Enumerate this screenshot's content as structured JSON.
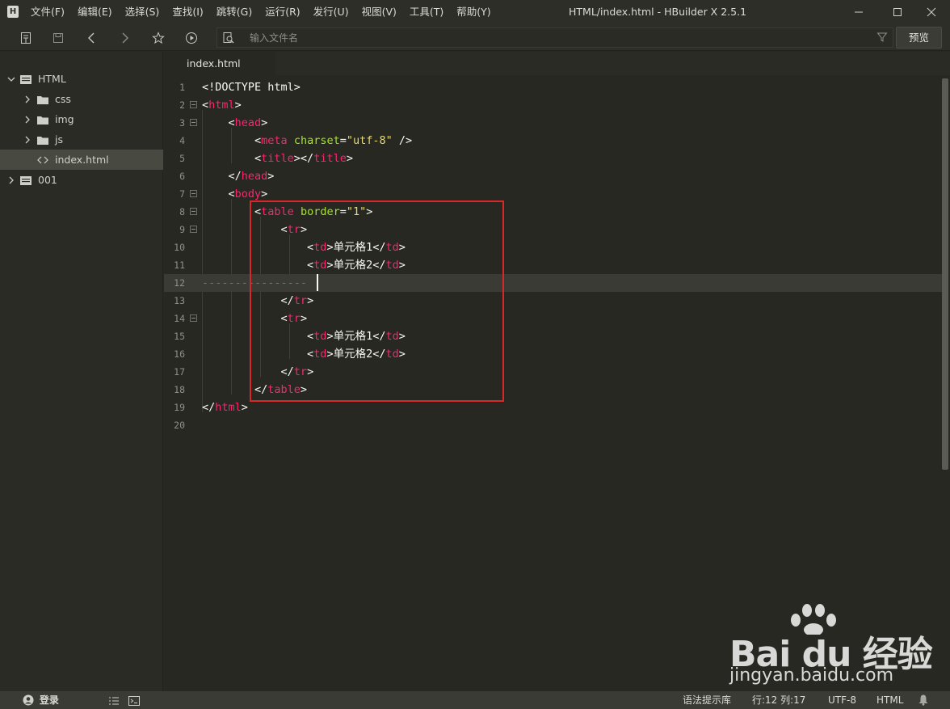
{
  "app": {
    "logo_letter": "H",
    "window_title": "HTML/index.html - HBuilder X 2.5.1"
  },
  "menu": [
    "文件(F)",
    "编辑(E)",
    "选择(S)",
    "查找(I)",
    "跳转(G)",
    "运行(R)",
    "发行(U)",
    "视图(V)",
    "工具(T)",
    "帮助(Y)"
  ],
  "toolbar": {
    "search_placeholder": "输入文件名",
    "preview_label": "预览"
  },
  "sidebar": {
    "tree": [
      {
        "label": "HTML",
        "type": "folder",
        "expanded": true
      },
      {
        "label": "css",
        "type": "folder",
        "expanded": false
      },
      {
        "label": "img",
        "type": "folder",
        "expanded": false
      },
      {
        "label": "js",
        "type": "folder",
        "expanded": false
      },
      {
        "label": "index.html",
        "type": "file",
        "selected": true
      },
      {
        "label": "001",
        "type": "folder",
        "expanded": false
      }
    ]
  },
  "tabs": [
    {
      "label": "index.html",
      "active": true
    }
  ],
  "editor": {
    "line_numbers": [
      "1",
      "2",
      "3",
      "4",
      "5",
      "6",
      "7",
      "8",
      "9",
      "10",
      "11",
      "12",
      "13",
      "14",
      "15",
      "16",
      "17",
      "18",
      "19",
      "20"
    ],
    "current_line": 12,
    "folded_lines": [
      2,
      3,
      7,
      8,
      9,
      14
    ]
  },
  "statusbar": {
    "login_label": "登录",
    "syntax_hint": "语法提示库",
    "position": "行:12  列:17",
    "encoding": "UTF-8",
    "language": "HTML"
  },
  "watermark": {
    "brand": "Bai du 经验",
    "url": "jingyan.baidu.com"
  },
  "colors": {
    "editor_bg": "#272822",
    "tag": "#f92672",
    "attribute": "#a6e22e",
    "string": "#e6db74",
    "highlight_box": "#d8282a"
  }
}
